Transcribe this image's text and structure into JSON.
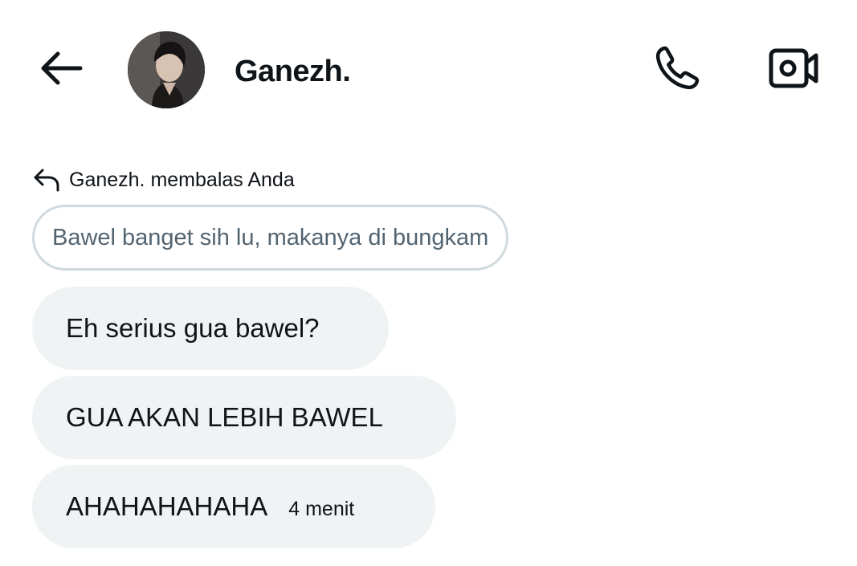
{
  "header": {
    "contact_name": "Ganezh.",
    "back_icon": "arrow-left-icon",
    "call_icon": "phone-icon",
    "video_icon": "video-camera-icon"
  },
  "reply_context": {
    "icon": "reply-arrow-icon",
    "text": "Ganezh. membalas Anda"
  },
  "quoted_message": {
    "text": "Bawel banget sih lu, makanya di bungkam"
  },
  "messages": [
    {
      "text": "Eh serius gua bawel?"
    },
    {
      "text": "GUA AKAN LEBIH BAWEL"
    },
    {
      "text": "AHAHAHAHAHA",
      "timestamp": "4 menit"
    }
  ],
  "colors": {
    "bubble_bg": "#eff3f4",
    "quoted_border": "#cfd9de",
    "quoted_text": "#536471",
    "text": "#0f1419"
  }
}
